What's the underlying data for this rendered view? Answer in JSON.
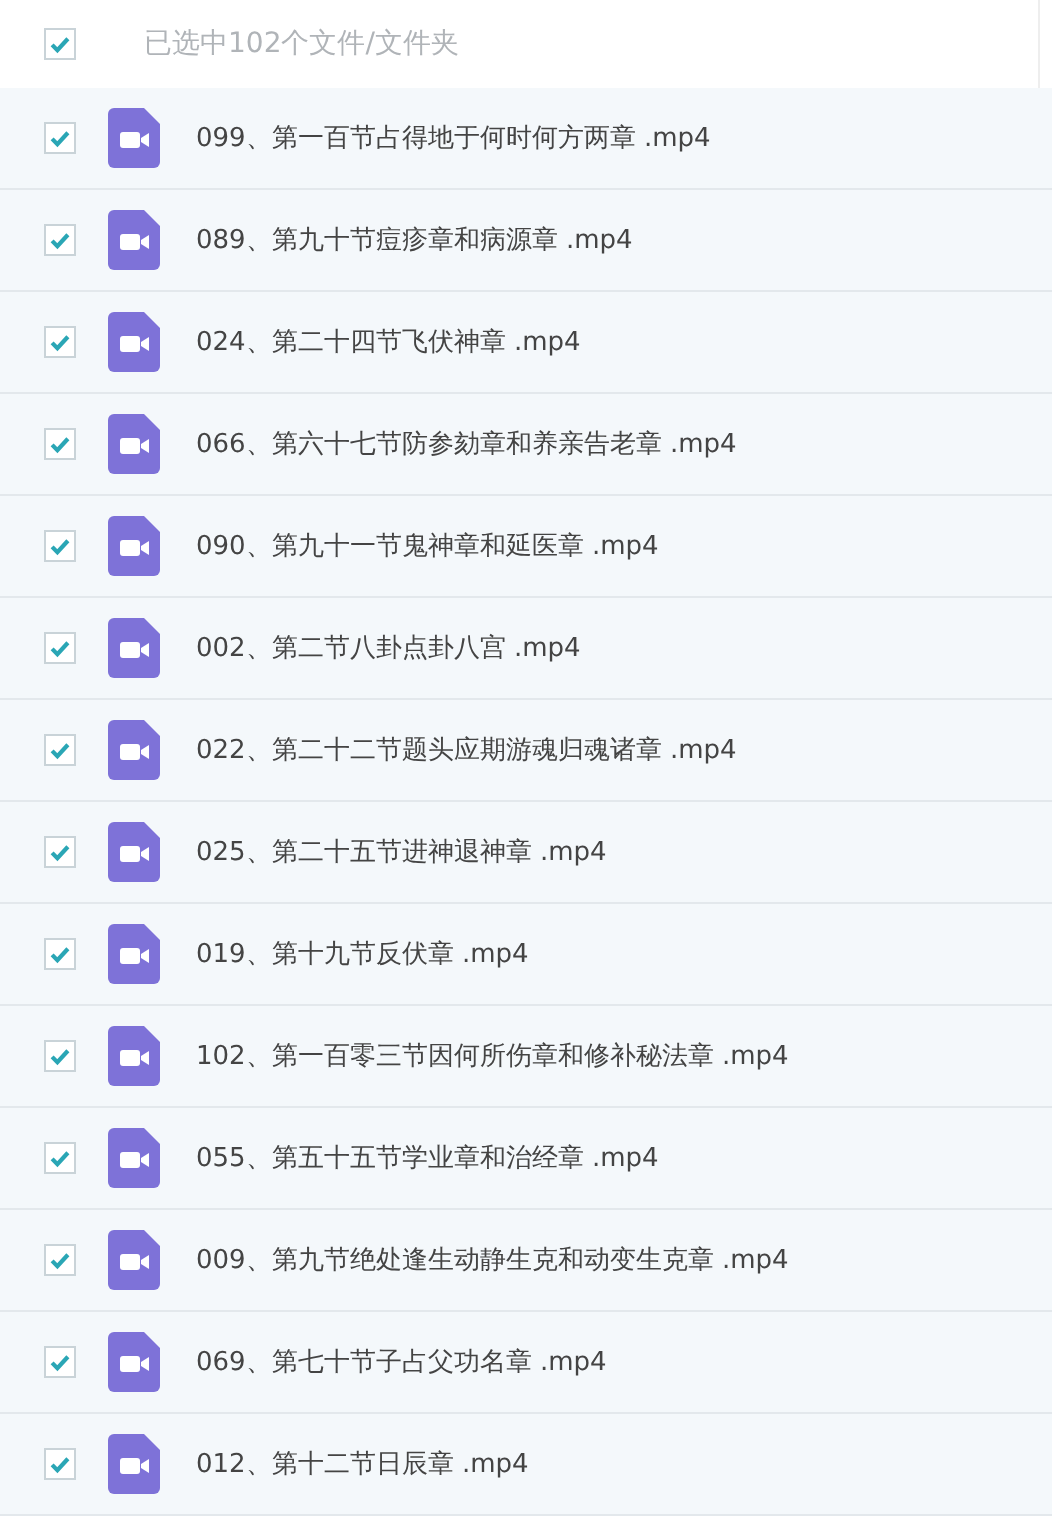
{
  "header": {
    "checked": true,
    "selection_label": "已选中102个文件/文件夹"
  },
  "files": [
    {
      "name": "099、第一百节占得地于何时何方两章 .mp4",
      "checked": true
    },
    {
      "name": "089、第九十节痘疹章和病源章 .mp4",
      "checked": true
    },
    {
      "name": "024、第二十四节飞伏神章 .mp4",
      "checked": true
    },
    {
      "name": "066、第六十七节防参劾章和养亲告老章 .mp4",
      "checked": true
    },
    {
      "name": "090、第九十一节鬼神章和延医章 .mp4",
      "checked": true
    },
    {
      "name": "002、第二节八卦点卦八宫 .mp4",
      "checked": true
    },
    {
      "name": "022、第二十二节题头应期游魂归魂诸章 .mp4",
      "checked": true
    },
    {
      "name": "025、第二十五节进神退神章 .mp4",
      "checked": true
    },
    {
      "name": "019、第十九节反伏章 .mp4",
      "checked": true
    },
    {
      "name": "102、第一百零三节因何所伤章和修补秘法章 .mp4",
      "checked": true
    },
    {
      "name": "055、第五十五节学业章和治经章 .mp4",
      "checked": true
    },
    {
      "name": "009、第九节绝处逢生动静生克和动变生克章 .mp4",
      "checked": true
    },
    {
      "name": "069、第七十节子占父功名章 .mp4",
      "checked": true
    },
    {
      "name": "012、第十二节日辰章 .mp4",
      "checked": true
    }
  ]
}
